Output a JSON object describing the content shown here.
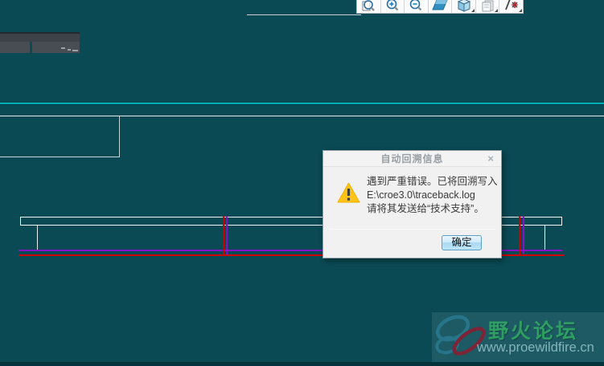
{
  "app": {
    "type": "cad-viewport-with-error",
    "canvas_bg": "#0a4a54"
  },
  "toolbar": {
    "buttons": [
      {
        "name": "zoom-fit",
        "icon": "magnifier-page-icon"
      },
      {
        "name": "zoom-in",
        "icon": "magnifier-plus-icon"
      },
      {
        "name": "zoom-out",
        "icon": "magnifier-minus-icon"
      },
      {
        "name": "repaint",
        "icon": "blue-parallelogram-icon"
      },
      {
        "name": "display-style",
        "icon": "shaded-cube-icon",
        "has_dropdown": true
      },
      {
        "name": "saved-orientations",
        "icon": "page-stack-icon",
        "has_dropdown": true
      },
      {
        "name": "datum-display",
        "icon": "datum-marks-icon",
        "has_dropdown": true
      }
    ]
  },
  "dialog": {
    "title": "自动回溯信息",
    "close_glyph": "×",
    "message_line1": "遇到严重错误。已将回溯写入",
    "message_line2": "E:\\croe3.0\\traceback.log",
    "message_line3": "请将其发送给“技术支持”。",
    "ok_label": "确定"
  },
  "watermark": {
    "site_name": "野火论坛",
    "site_url": "www.proewildfire.cn"
  },
  "colors": {
    "canvas_bg": "#0a4a54",
    "cyan_line": "#00dce0",
    "white_line": "#dfe9ea",
    "purple_line": "#8a10c8",
    "red_line": "#d40000",
    "bottom_strip": "#05333c",
    "dialog_bg": "#f1f1f1",
    "dialog_title_color": "#979ea4",
    "warning_yellow": "#ffc31a",
    "ok_button_border": "#5f9fc6",
    "watermark_green": "#2f9e62",
    "watermark_url_color": "#85b4bb",
    "watermark_maroon": "#7d2536",
    "watermark_teal": "#26758a"
  }
}
